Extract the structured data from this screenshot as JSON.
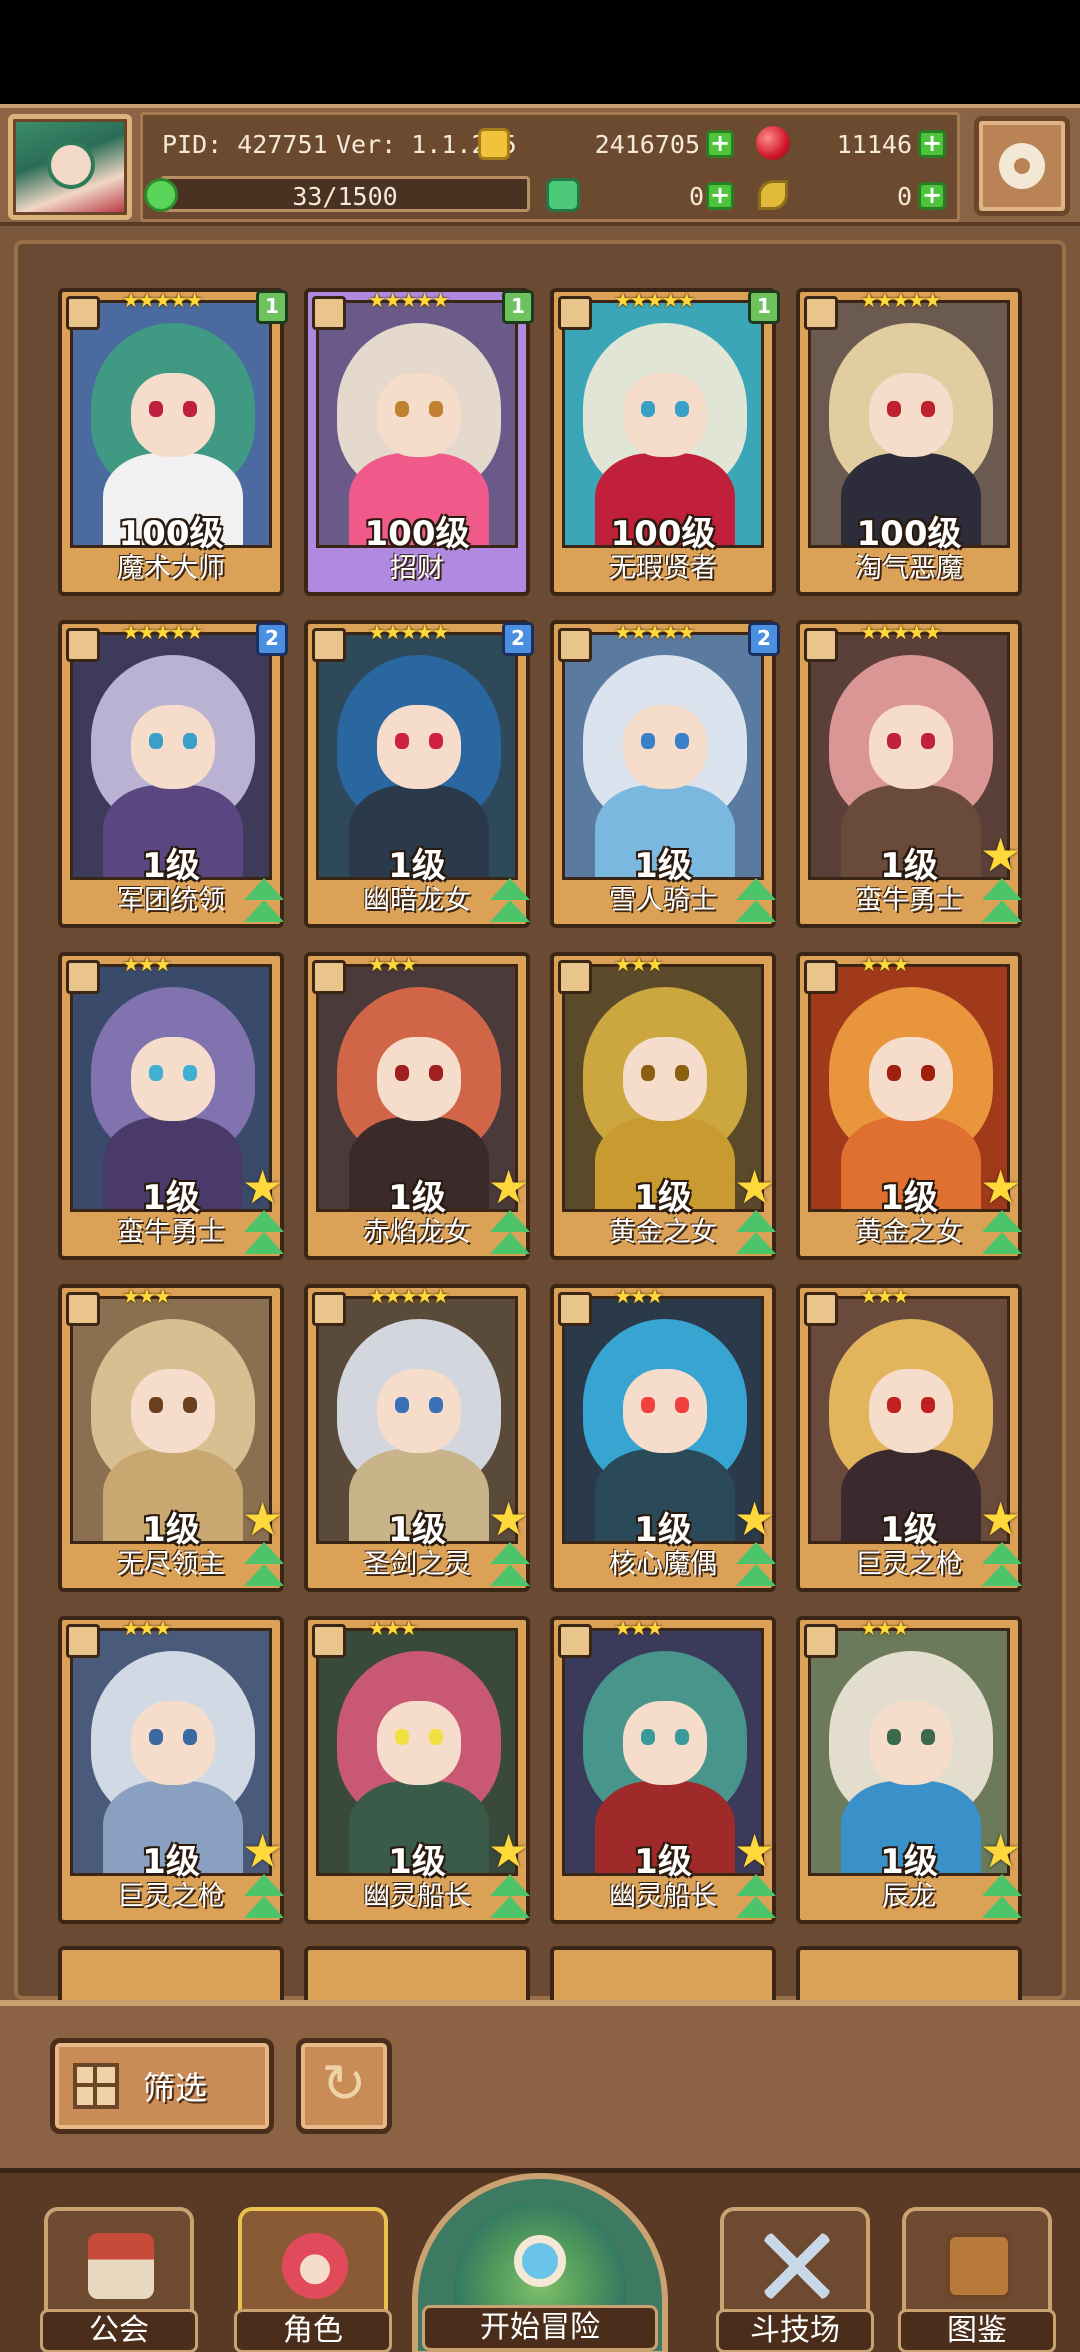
{
  "header": {
    "pid_label": "PID: 427751",
    "version_label": "Ver: 1.1.2.5",
    "gold": "2416705",
    "ruby": "11146",
    "energy": "33/1500",
    "clover": "0",
    "leaf": "0"
  },
  "heroes": [
    {
      "name": "魔术大师",
      "level": "100级",
      "stars": "★★★★★",
      "rank": "1",
      "rank_color": "green",
      "frame": "gold",
      "hair": "#3f9e80",
      "body": "#f1f1f1",
      "eye": "#c02040",
      "bg": "#4a6aa0"
    },
    {
      "name": "招财",
      "level": "100级",
      "stars": "★★★★★",
      "rank": "1",
      "rank_color": "green",
      "frame": "purple",
      "hair": "#f3e6d4",
      "body": "#f05a8a",
      "eye": "#c08030",
      "bg": "#6a5a8a"
    },
    {
      "name": "无瑕贤者",
      "level": "100级",
      "stars": "★★★★★",
      "rank": "1",
      "rank_color": "green",
      "frame": "gold",
      "hair": "#f4ecd8",
      "body": "#c0203a",
      "eye": "#3aa0c8",
      "bg": "#3aa6b8"
    },
    {
      "name": "淘气恶魔",
      "level": "100级",
      "stars": "★★★★★",
      "rank": "",
      "rank_color": "",
      "frame": "gold",
      "hair": "#f0d9a8",
      "body": "#2c2c3a",
      "eye": "#c02030",
      "bg": "#6b5a50"
    },
    {
      "name": "军团统领",
      "level": "1级",
      "stars": "★★★★★",
      "rank": "2",
      "rank_color": "blue",
      "frame": "gold",
      "hair": "#c8c0e0",
      "body": "#5a4680",
      "eye": "#3aa0c8",
      "bg": "#3e3a5a"
    },
    {
      "name": "幽暗龙女",
      "level": "1级",
      "stars": "★★★★★",
      "rank": "2",
      "rank_color": "blue",
      "frame": "gold",
      "hair": "#2a6aa8",
      "body": "#2a3a4a",
      "eye": "#d02040",
      "bg": "#2e4a5a"
    },
    {
      "name": "雪人骑士",
      "level": "1级",
      "stars": "★★★★★",
      "rank": "2",
      "rank_color": "blue",
      "frame": "gold",
      "hair": "#e8eef6",
      "body": "#7ab8e0",
      "eye": "#3a80c8",
      "bg": "#5a7aa0"
    },
    {
      "name": "蛮牛勇士",
      "level": "1级",
      "stars": "★★★★★",
      "rank": "",
      "rank_color": "",
      "frame": "gold",
      "hair": "#e8a0a0",
      "body": "#6a4a3a",
      "eye": "#c02040",
      "bg": "#5a4038"
    },
    {
      "name": "蛮牛勇士",
      "level": "1级",
      "stars": "★★★",
      "rank": "",
      "rank_color": "",
      "frame": "gold",
      "hair": "#8a78b8",
      "body": "#4a3a6a",
      "eye": "#40b0d0",
      "bg": "#3a4a6a"
    },
    {
      "name": "赤焰龙女",
      "level": "1级",
      "stars": "★★★",
      "rank": "",
      "rank_color": "",
      "frame": "gold",
      "hair": "#e06a4a",
      "body": "#3a2a2a",
      "eye": "#a02020",
      "bg": "#4a3a3a"
    },
    {
      "name": "黄金之女",
      "level": "1级",
      "stars": "★★★",
      "rank": "",
      "rank_color": "",
      "frame": "gold",
      "hair": "#d8b040",
      "body": "#c89a30",
      "eye": "#8a6010",
      "bg": "#5a4a2a"
    },
    {
      "name": "黄金之女",
      "level": "1级",
      "stars": "★★★",
      "rank": "",
      "rank_color": "",
      "frame": "gold",
      "hair": "#f0a040",
      "body": "#e07030",
      "eye": "#a02010",
      "bg": "#a03a1a"
    },
    {
      "name": "无尽领主",
      "level": "1级",
      "stars": "★★★",
      "rank": "",
      "rank_color": "",
      "frame": "gold",
      "hair": "#e0c898",
      "body": "#c8a870",
      "eye": "#6a4020",
      "bg": "#8a7050"
    },
    {
      "name": "圣剑之灵",
      "level": "1级",
      "stars": "★★★★★",
      "rank": "",
      "rank_color": "",
      "frame": "gold",
      "hair": "#e0e6f0",
      "body": "#c8b488",
      "eye": "#3a70b8",
      "bg": "#5a4a3a"
    },
    {
      "name": "核心魔偶",
      "level": "1级",
      "stars": "★★★",
      "rank": "",
      "rank_color": "",
      "frame": "gold",
      "hair": "#3ab0e0",
      "body": "#2a4a5a",
      "eye": "#f04040",
      "bg": "#2a3a4a"
    },
    {
      "name": "巨灵之枪",
      "level": "1级",
      "stars": "★★★",
      "rank": "",
      "rank_color": "",
      "frame": "gold",
      "hair": "#f0c060",
      "body": "#3a2a30",
      "eye": "#c02020",
      "bg": "#6a4a3a"
    },
    {
      "name": "巨灵之枪",
      "level": "1级",
      "stars": "★★★",
      "rank": "",
      "rank_color": "",
      "frame": "gold",
      "hair": "#e0e8f0",
      "body": "#8aa0c0",
      "eye": "#3a6aa0",
      "bg": "#4a5a7a"
    },
    {
      "name": "幽灵船长",
      "level": "1级",
      "stars": "★★★",
      "rank": "",
      "rank_color": "",
      "frame": "gold",
      "hair": "#d85a7a",
      "body": "#3a5a4a",
      "eye": "#f0e040",
      "bg": "#3a4a3a"
    },
    {
      "name": "幽灵船长",
      "level": "1级",
      "stars": "★★★",
      "rank": "",
      "rank_color": "",
      "frame": "gold",
      "hair": "#4aa090",
      "body": "#a02a2a",
      "eye": "#3a9a9a",
      "bg": "#3a3a5a"
    },
    {
      "name": "辰龙",
      "level": "1级",
      "stars": "★★★",
      "rank": "",
      "rank_color": "",
      "frame": "gold",
      "hair": "#f0e8d8",
      "body": "#3a90c8",
      "eye": "#3a6a4a",
      "bg": "#6a7a5a"
    }
  ],
  "filter": {
    "label": "筛选"
  },
  "nav": {
    "guild": "公会",
    "character": "角色",
    "adventure": "开始冒险",
    "arena": "斗技场",
    "codex": "图鉴"
  }
}
